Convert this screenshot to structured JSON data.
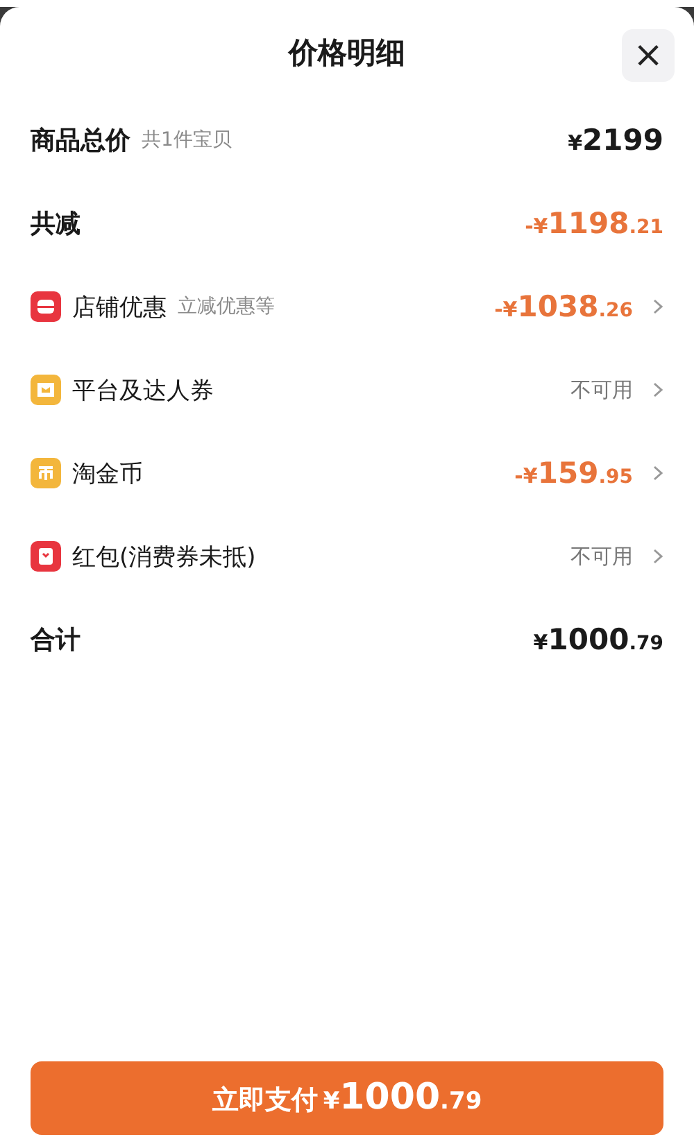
{
  "sheet": {
    "title": "价格明细",
    "close": "×"
  },
  "rows": [
    {
      "kind": "subtotal",
      "label": "商品总价",
      "note": "共1件宝贝",
      "amount": {
        "prefix": "¥",
        "main": "2199"
      }
    },
    {
      "kind": "discount",
      "label": "共减",
      "amount": {
        "prefix": "-¥",
        "main": "1198",
        "fraction": ".21"
      }
    },
    {
      "kind": "item",
      "color": "#e8353f",
      "label": "店铺优惠",
      "note": "立减优惠等",
      "amount": {
        "prefix": "-¥",
        "main": "1038",
        "fraction": ".26"
      }
    },
    {
      "kind": "item",
      "color": "#f3b63c",
      "label": "平台及达人券",
      "status": "不可用"
    },
    {
      "kind": "item",
      "color": "#f3b63c",
      "label": "淘金币",
      "amount": {
        "prefix": "-¥",
        "main": "159",
        "fraction": ".95"
      }
    },
    {
      "kind": "item",
      "color": "#e8353f",
      "label": "红包(消费券未抵)",
      "status": "不可用"
    },
    {
      "kind": "subtotal",
      "label": "合计",
      "amount": {
        "prefix": "¥",
        "main": "1000",
        "fraction": ".79"
      }
    }
  ],
  "pay_button": {
    "label": "立即支付",
    "amount": {
      "prefix": "¥",
      "main": "1000",
      "fraction": ".79"
    }
  }
}
